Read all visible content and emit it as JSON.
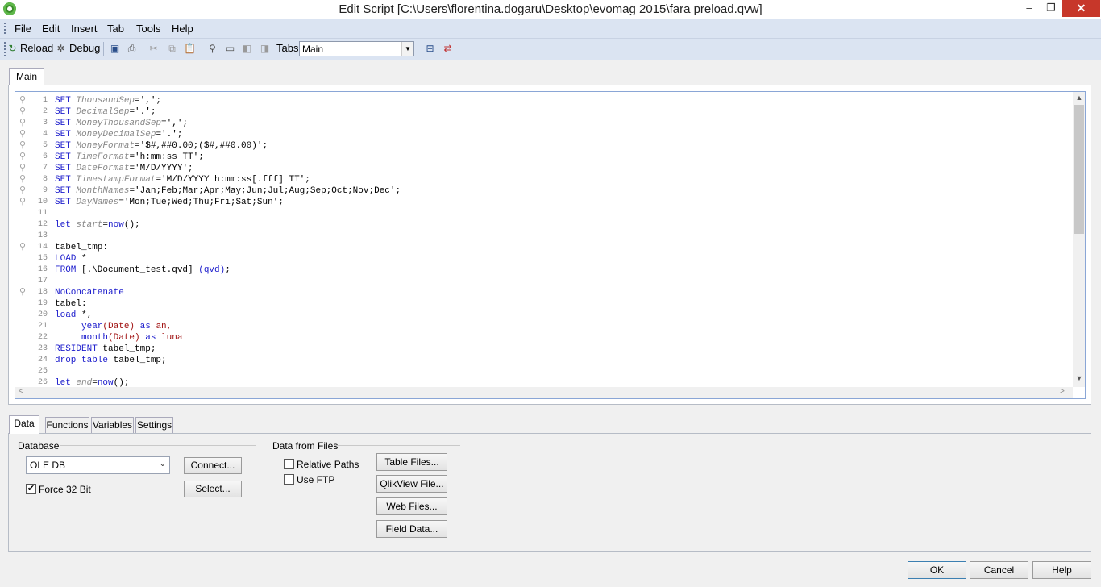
{
  "window": {
    "title": "Edit Script [C:\\Users\\florentina.dogaru\\Desktop\\evomag 2015\\fara preload.qvw]",
    "minimize": "–",
    "maximize": "❐",
    "close": "✕"
  },
  "menu": [
    "File",
    "Edit",
    "Insert",
    "Tab",
    "Tools",
    "Help"
  ],
  "toolbar": {
    "reload": "Reload",
    "debug": "Debug",
    "tabs_label": "Tabs",
    "tabs_value": "Main"
  },
  "script_tab": "Main",
  "script_lines": [
    {
      "n": "1"
    },
    {
      "n": "2"
    },
    {
      "n": "3"
    },
    {
      "n": "4"
    },
    {
      "n": "5"
    },
    {
      "n": "6"
    },
    {
      "n": "7"
    },
    {
      "n": "8"
    },
    {
      "n": "9"
    },
    {
      "n": "10"
    },
    {
      "n": "11"
    },
    {
      "n": "12"
    },
    {
      "n": "13"
    },
    {
      "n": "14"
    },
    {
      "n": "15"
    },
    {
      "n": "16"
    },
    {
      "n": "17"
    },
    {
      "n": "18"
    },
    {
      "n": "19"
    },
    {
      "n": "20"
    },
    {
      "n": "21"
    },
    {
      "n": "22"
    },
    {
      "n": "23"
    },
    {
      "n": "24"
    },
    {
      "n": "25"
    },
    {
      "n": "26"
    }
  ],
  "code": {
    "l1": [
      "SET",
      " ThousandSep",
      "=',';"
    ],
    "l2": [
      "SET",
      " DecimalSep",
      "='.';"
    ],
    "l3": [
      "SET",
      " MoneyThousandSep",
      "=',';"
    ],
    "l4": [
      "SET",
      " MoneyDecimalSep",
      "='.';"
    ],
    "l5": [
      "SET",
      " MoneyFormat",
      "='$#,##0.00;($#,##0.00)';"
    ],
    "l6": [
      "SET",
      " TimeFormat",
      "='h:mm:ss TT';"
    ],
    "l7": [
      "SET",
      " DateFormat",
      "='M/D/YYYY';"
    ],
    "l8": [
      "SET",
      " TimestampFormat",
      "='M/D/YYYY h:mm:ss[.fff] TT';"
    ],
    "l9": [
      "SET",
      " MonthNames",
      "='Jan;Feb;Mar;Apr;May;Jun;Jul;Aug;Sep;Oct;Nov;Dec';"
    ],
    "l10": [
      "SET",
      " DayNames",
      "='Mon;Tue;Wed;Thu;Fri;Sat;Sun';"
    ],
    "l12": [
      "let",
      " start",
      "=",
      "now",
      "();"
    ],
    "l14": "tabel_tmp:",
    "l15": [
      "LOAD",
      " *"
    ],
    "l16": [
      "FROM",
      " [.\\Document_test.qvd] ",
      "(qvd)",
      ";"
    ],
    "l18": "NoConcatenate",
    "l19": "tabel:",
    "l20": [
      "load",
      " *,"
    ],
    "l21": [
      "     year",
      "(Date)",
      " as",
      " an,"
    ],
    "l22": [
      "     month",
      "(Date)",
      " as",
      " luna"
    ],
    "l23": [
      "RESIDENT",
      " tabel_tmp;"
    ],
    "l24": [
      "drop table",
      " tabel_tmp;"
    ],
    "l26": [
      "let",
      " end",
      "=",
      "now",
      "();"
    ]
  },
  "bottom_tabs": [
    "Data",
    "Functions",
    "Variables",
    "Settings"
  ],
  "database": {
    "group_label": "Database",
    "select_value": "OLE DB",
    "connect_button": "Connect...",
    "select_button": "Select...",
    "force32_label": "Force 32 Bit",
    "force32_checked": true
  },
  "files": {
    "group_label": "Data from Files",
    "relative_paths": "Relative Paths",
    "use_ftp": "Use FTP",
    "table_files": "Table Files...",
    "qlikview_file": "QlikView File...",
    "web_files": "Web Files...",
    "field_data": "Field Data..."
  },
  "dialog_buttons": {
    "ok": "OK",
    "cancel": "Cancel",
    "help": "Help"
  }
}
